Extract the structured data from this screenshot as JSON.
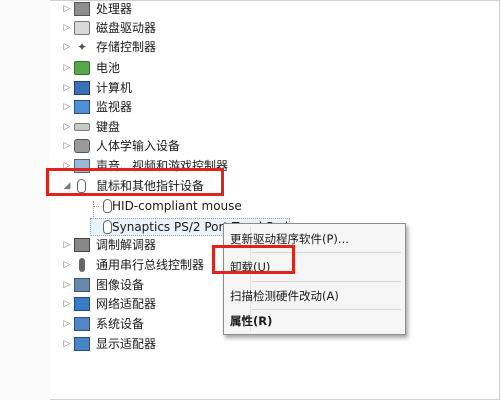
{
  "tree": {
    "items": [
      {
        "label": "处理器",
        "icon": "processor-icon",
        "expander": "▷"
      },
      {
        "label": "磁盘驱动器",
        "icon": "disk-drive-icon",
        "expander": "▷"
      },
      {
        "label": "存储控制器",
        "icon": "storage-controller-icon",
        "expander": "▷"
      },
      {
        "label": "电池",
        "icon": "battery-icon",
        "expander": "▷"
      },
      {
        "label": "计算机",
        "icon": "computer-icon",
        "expander": "▷"
      },
      {
        "label": "监视器",
        "icon": "monitor-icon",
        "expander": "▷"
      },
      {
        "label": "键盘",
        "icon": "keyboard-icon",
        "expander": "▷"
      },
      {
        "label": "人体学输入设备",
        "icon": "hid-icon",
        "expander": "▷"
      },
      {
        "label": "声音、视频和游戏控制器",
        "icon": "sound-icon",
        "expander": "▷"
      },
      {
        "label": "鼠标和其他指针设备",
        "icon": "mouse-icon",
        "expander": "◢"
      },
      {
        "label": "HID-compliant mouse",
        "icon": "mouse-icon"
      },
      {
        "label": "Synaptics PS/2 Port TouchPad",
        "icon": "mouse-icon"
      },
      {
        "label": "调制解调器",
        "icon": "modem-icon",
        "expander": "▷"
      },
      {
        "label": "通用串行总线控制器",
        "icon": "usb-icon",
        "expander": "▷"
      },
      {
        "label": "图像设备",
        "icon": "imaging-device-icon",
        "expander": "▷"
      },
      {
        "label": "网络适配器",
        "icon": "network-adapter-icon",
        "expander": "▷"
      },
      {
        "label": "系统设备",
        "icon": "system-device-icon",
        "expander": "▷"
      },
      {
        "label": "显示适配器",
        "icon": "display-adapter-icon",
        "expander": "▷"
      }
    ]
  },
  "context_menu": {
    "items": [
      {
        "label": "更新驱动程序软件(P)..."
      },
      {
        "label": "卸载(U)"
      },
      {
        "label": "扫描检测硬件改动(A)"
      },
      {
        "label": "属性(R)"
      }
    ]
  },
  "colors": {
    "highlight": "#e0241b",
    "menu_bg": "#f5f5f5",
    "selection": "#eaf2fb"
  }
}
